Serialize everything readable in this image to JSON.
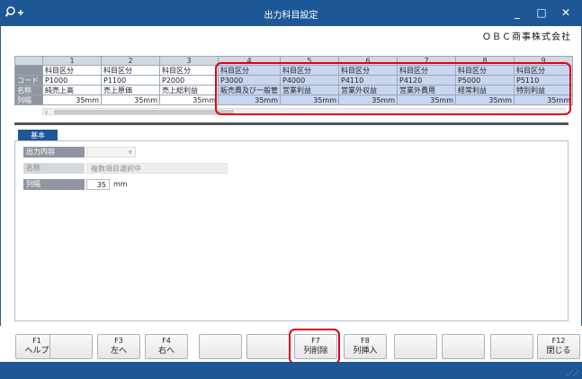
{
  "window": {
    "title": "出力科目設定",
    "controls": [
      "_",
      "□",
      "✕"
    ]
  },
  "company": "ＯＢＣ商事株式会社",
  "grid": {
    "column_numbers": [
      "1",
      "2",
      "3",
      "4",
      "5",
      "6",
      "7",
      "8",
      "9"
    ],
    "row_headers": [
      "",
      "コード",
      "名称",
      "列幅"
    ],
    "kubun_label": "科目区分",
    "columns": [
      {
        "code": "P1000",
        "name": "純売上高",
        "width": "35mm"
      },
      {
        "code": "P1100",
        "name": "売上原価",
        "width": "35mm"
      },
      {
        "code": "P2000",
        "name": "売上総利益",
        "width": "35mm"
      },
      {
        "code": "P3000",
        "name": "販売費及び一般管",
        "width": "35mm"
      },
      {
        "code": "P4000",
        "name": "営業利益",
        "width": "35mm"
      },
      {
        "code": "P4110",
        "name": "営業外収益",
        "width": "35mm"
      },
      {
        "code": "P4120",
        "name": "営業外費用",
        "width": "35mm"
      },
      {
        "code": "P5000",
        "name": "経常利益",
        "width": "35mm"
      },
      {
        "code": "P5110",
        "name": "特別利益",
        "width": "35mm"
      }
    ],
    "selected_from": 4
  },
  "tab": {
    "label": "基本"
  },
  "form": {
    "output_label": "出力内容",
    "name_label": "名称",
    "name_value": "複数項目選択中",
    "width_label": "列幅",
    "width_value": "35",
    "width_unit": "mm"
  },
  "fkeys": [
    {
      "key": "F1",
      "label": "ヘルプ"
    },
    {
      "key": "",
      "label": ""
    },
    {
      "key": "F3",
      "label": "左へ"
    },
    {
      "key": "F4",
      "label": "右へ"
    },
    {
      "key": "",
      "label": ""
    },
    {
      "key": "",
      "label": ""
    },
    {
      "key": "F7",
      "label": "列削除"
    },
    {
      "key": "F8",
      "label": "列挿入"
    },
    {
      "key": "",
      "label": ""
    },
    {
      "key": "",
      "label": ""
    },
    {
      "key": "",
      "label": ""
    },
    {
      "key": "F12",
      "label": "閉じる"
    }
  ],
  "colors": {
    "titlebar": "#1e5796",
    "highlight": "#e0001b",
    "selected": "#c8d6f1"
  }
}
